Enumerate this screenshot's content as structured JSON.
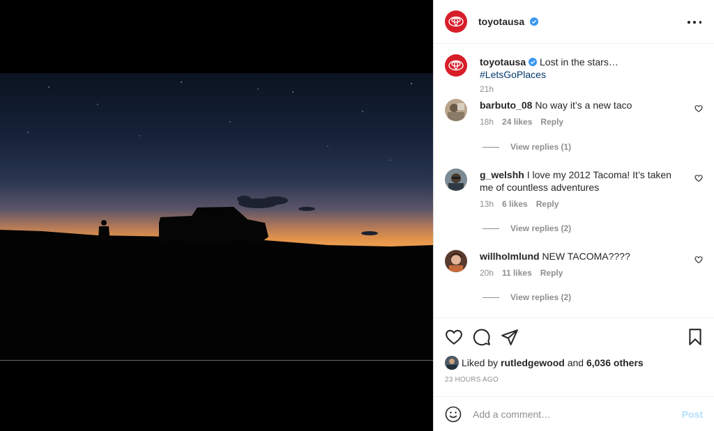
{
  "post": {
    "username": "toyotausa",
    "caption_text": "Lost in the stars… ",
    "caption_hashtag": "#LetsGoPlaces",
    "caption_time": "21h"
  },
  "comments": [
    {
      "username": "barbuto_08",
      "text": "No way it’s a new taco",
      "time": "18h",
      "likes": "24 likes",
      "reply": "Reply",
      "view_replies": "View replies (1)"
    },
    {
      "username": "g_welshh",
      "text": "I love my 2012 Tacoma! It’s taken me of countless adventures",
      "time": "13h",
      "likes": "6 likes",
      "reply": "Reply",
      "view_replies": "View replies (2)"
    },
    {
      "username": "willholmlund",
      "text": "NEW TACOMA????",
      "time": "20h",
      "likes": "11 likes",
      "reply": "Reply",
      "view_replies": "View replies (2)"
    }
  ],
  "liked_by": {
    "prefix": "Liked by ",
    "user": "rutledgewood",
    "middle": " and ",
    "count": "6,036 others"
  },
  "timestamp": "23 HOURS AGO",
  "add_comment": {
    "placeholder": "Add a comment…",
    "post_label": "Post"
  },
  "icons": {
    "header_more": "more-horizontal-icon",
    "like": "heart-icon",
    "comment": "comment-bubble-icon",
    "share": "paper-plane-icon",
    "save": "bookmark-icon",
    "emoji": "smiley-icon",
    "verified": "verified-badge-icon"
  },
  "colors": {
    "brand_red": "#d71e29",
    "verified_blue": "#3897f0",
    "hashtag": "#00376b",
    "post_disabled": "#b2dffc"
  }
}
